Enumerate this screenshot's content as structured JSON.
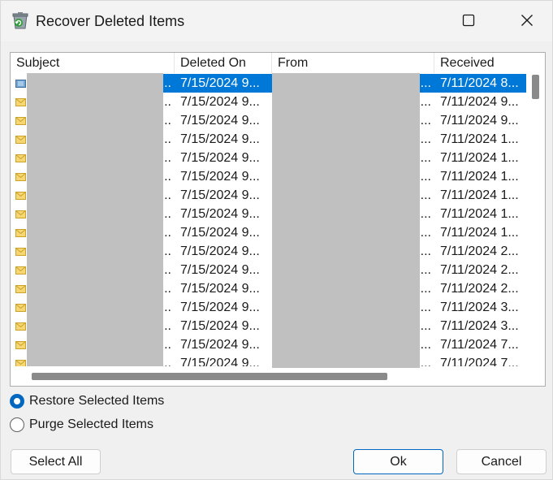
{
  "window": {
    "title": "Recover Deleted Items",
    "icons": {
      "app": "recover-items-icon",
      "maximize": "maximize-icon",
      "close": "close-icon"
    }
  },
  "list": {
    "columns": [
      "Subject",
      "Deleted On",
      "From",
      "Received"
    ],
    "rows": [
      {
        "subject": "...",
        "deleted_on": "7/15/2024 9...",
        "from": "...",
        "received": "7/11/2024 8...",
        "selected": true,
        "icon": "meeting-icon"
      },
      {
        "subject": "...",
        "deleted_on": "7/15/2024 9...",
        "from": "...",
        "received": "7/11/2024 9...",
        "icon": "envelope-icon"
      },
      {
        "subject": "...",
        "deleted_on": "7/15/2024 9...",
        "from": "...",
        "received": "7/11/2024 9...",
        "icon": "envelope-icon"
      },
      {
        "subject": "...",
        "deleted_on": "7/15/2024 9...",
        "from": "...",
        "received": "7/11/2024 1...",
        "icon": "envelope-icon"
      },
      {
        "subject": "...",
        "deleted_on": "7/15/2024 9...",
        "from": "...",
        "received": "7/11/2024 1...",
        "icon": "envelope-icon"
      },
      {
        "subject": "...",
        "deleted_on": "7/15/2024 9...",
        "from": "...",
        "received": "7/11/2024 1...",
        "icon": "envelope-icon"
      },
      {
        "subject": "...",
        "deleted_on": "7/15/2024 9...",
        "from": "...",
        "received": "7/11/2024 1...",
        "icon": "envelope-icon"
      },
      {
        "subject": "...",
        "deleted_on": "7/15/2024 9...",
        "from": "...",
        "received": "7/11/2024 1...",
        "icon": "envelope-icon"
      },
      {
        "subject": "...",
        "deleted_on": "7/15/2024 9...",
        "from": "...",
        "received": "7/11/2024 1...",
        "icon": "envelope-icon"
      },
      {
        "subject": "...",
        "deleted_on": "7/15/2024 9...",
        "from": "...",
        "received": "7/11/2024 2...",
        "icon": "envelope-icon"
      },
      {
        "subject": "...",
        "deleted_on": "7/15/2024 9...",
        "from": "...",
        "received": "7/11/2024 2...",
        "icon": "envelope-icon"
      },
      {
        "subject": "...",
        "deleted_on": "7/15/2024 9...",
        "from": "...",
        "received": "7/11/2024 2...",
        "icon": "envelope-icon"
      },
      {
        "subject": "...",
        "deleted_on": "7/15/2024 9...",
        "from": "...",
        "received": "7/11/2024 3...",
        "icon": "envelope-icon"
      },
      {
        "subject": "...",
        "deleted_on": "7/15/2024 9...",
        "from": "...",
        "received": "7/11/2024 3...",
        "icon": "envelope-icon"
      },
      {
        "subject": "...",
        "deleted_on": "7/15/2024 9...",
        "from": "...",
        "received": "7/11/2024 7...",
        "icon": "envelope-icon"
      },
      {
        "subject": "...",
        "deleted_on": "7/15/2024 9...",
        "from": "...",
        "received": "7/11/2024 7...",
        "icon": "envelope-icon"
      }
    ]
  },
  "options": {
    "restore_label": "Restore Selected Items",
    "purge_label": "Purge Selected Items",
    "selected": "restore"
  },
  "buttons": {
    "select_all": "Select All",
    "ok": "Ok",
    "cancel": "Cancel"
  },
  "colors": {
    "selection": "#0078d7",
    "accent": "#0067c0"
  }
}
